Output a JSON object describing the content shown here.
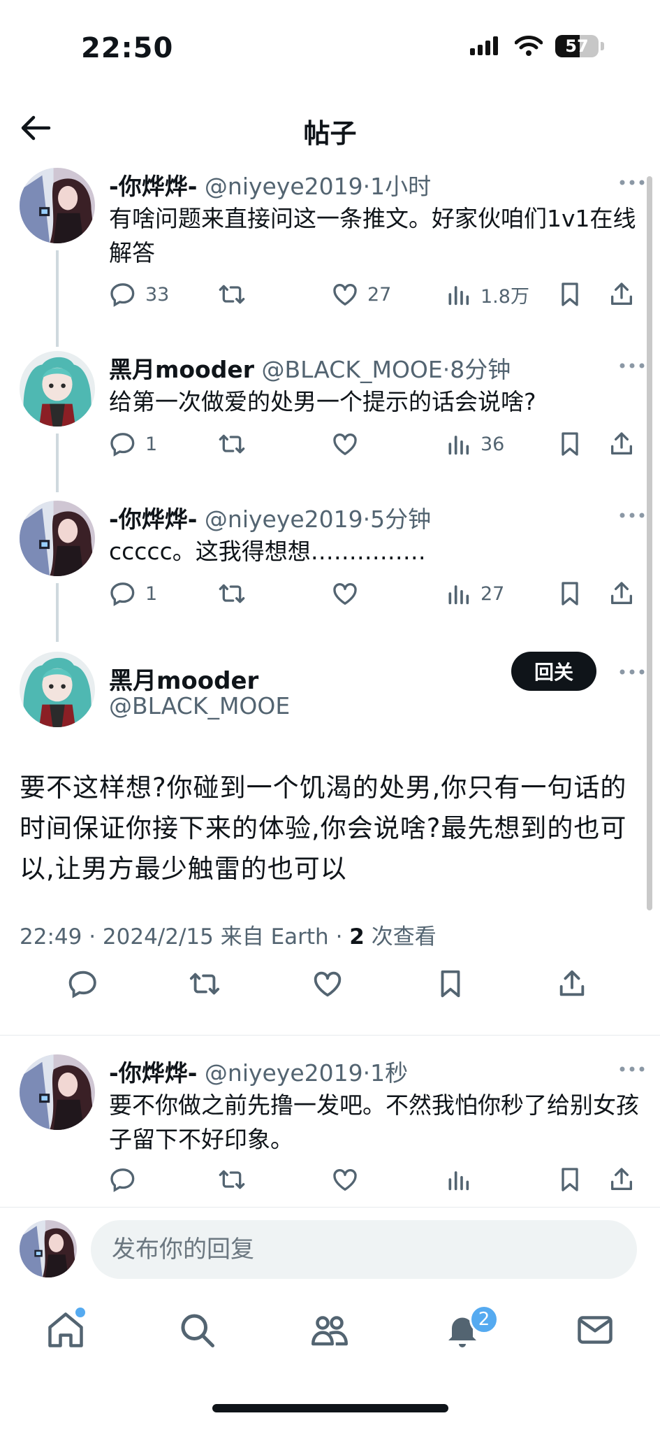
{
  "status": {
    "time": "22:50",
    "battery": "57",
    "battery_level": 0.57
  },
  "nav": {
    "title": "帖子"
  },
  "thread": [
    {
      "name": "-你烨烨-",
      "handle": "@niyeye2019",
      "sep": "·",
      "time": "1小时",
      "text": "有啥问题来直接问这一条推文。好家伙咱们1v1在线解答",
      "replies": "33",
      "retweets": "",
      "likes": "27",
      "views": "1.8万"
    },
    {
      "name": "黑月mooder",
      "handle": "@BLACK_MOOE",
      "sep": "·",
      "time": "8分钟",
      "text": "给第一次做爱的处男一个提示的话会说啥?",
      "replies": "1",
      "retweets": "",
      "likes": "",
      "views": "36"
    },
    {
      "name": "-你烨烨-",
      "handle": "@niyeye2019",
      "sep": "·",
      "time": "5分钟",
      "text": "ccccc。这我得想想……………",
      "replies": "1",
      "retweets": "",
      "likes": "",
      "views": "27"
    }
  ],
  "main_tweet": {
    "name": "黑月mooder",
    "handle": "@BLACK_MOOE",
    "follow_label": "回关",
    "text": "要不这样想?你碰到一个饥渴的处男,你只有一句话的时间保证你接下来的体验,你会说啥?最先想到的也可以,让男方最少触雷的也可以",
    "time": "22:49",
    "date": "2024/2/15",
    "source": "来自 Earth",
    "views_count": "2",
    "views_label": "次查看"
  },
  "reply": {
    "name": "-你烨烨-",
    "handle": "@niyeye2019",
    "sep": "·",
    "time": "1秒",
    "text": "要不你做之前先撸一发吧。不然我怕你秒了给别女孩子留下不好印象。"
  },
  "reply_bar": {
    "placeholder": "发布你的回复"
  },
  "tabbar": {
    "notification_count": "2"
  },
  "icons": [
    "back-arrow-icon",
    "more-icon",
    "reply-icon",
    "retweet-icon",
    "like-icon",
    "views-icon",
    "bookmark-icon",
    "share-icon",
    "home-icon",
    "search-icon",
    "communities-icon",
    "bell-icon",
    "mail-icon"
  ],
  "colors": {
    "text": "#0f1419",
    "secondary": "#536471",
    "badge": "#55aaf0",
    "input_bg": "#eff3f4"
  }
}
